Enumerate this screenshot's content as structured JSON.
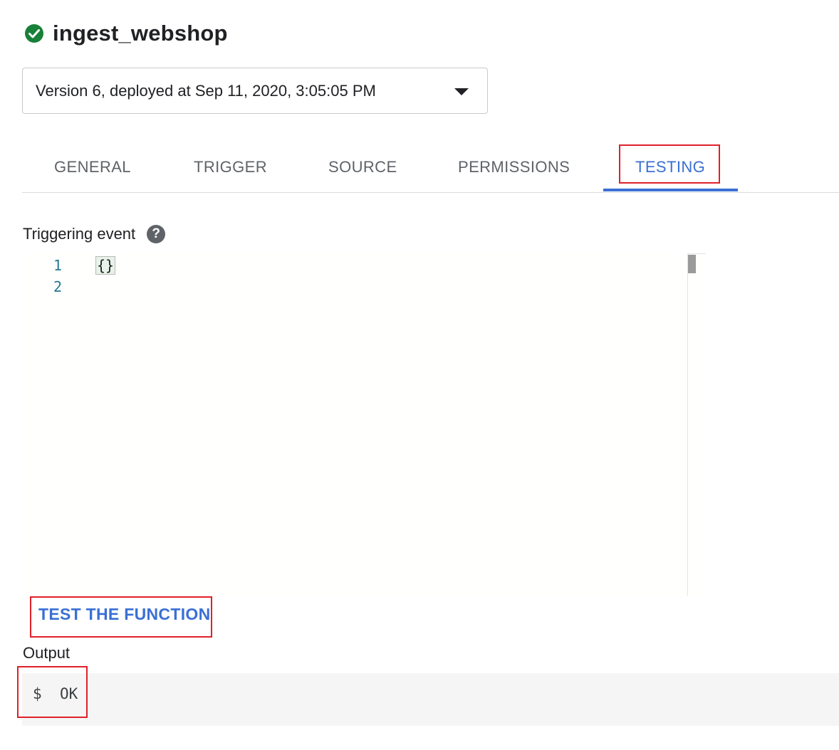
{
  "header": {
    "title": "ingest_webshop",
    "status_icon": "check-circle-icon",
    "status_color": "#188038"
  },
  "version_select": {
    "value": "Version 6, deployed at Sep 11, 2020, 3:05:05 PM",
    "icon": "caret-down-icon"
  },
  "tabs": [
    {
      "label": "GENERAL",
      "active": false
    },
    {
      "label": "TRIGGER",
      "active": false
    },
    {
      "label": "SOURCE",
      "active": false
    },
    {
      "label": "PERMISSIONS",
      "active": false
    },
    {
      "label": "TESTING",
      "active": true
    }
  ],
  "testing": {
    "triggering_event_label": "Triggering event",
    "help_icon": "help-icon",
    "editor": {
      "line_numbers": [
        "1",
        "2"
      ],
      "lines": [
        "{}",
        ""
      ]
    },
    "test_button_label": "TEST THE FUNCTION",
    "output_label": "Output",
    "output_prompt": "$",
    "output_value": "OK"
  },
  "colors": {
    "accent": "#3b6fd4",
    "highlight_border": "#e0202a",
    "tab_inactive": "#5f6368"
  }
}
